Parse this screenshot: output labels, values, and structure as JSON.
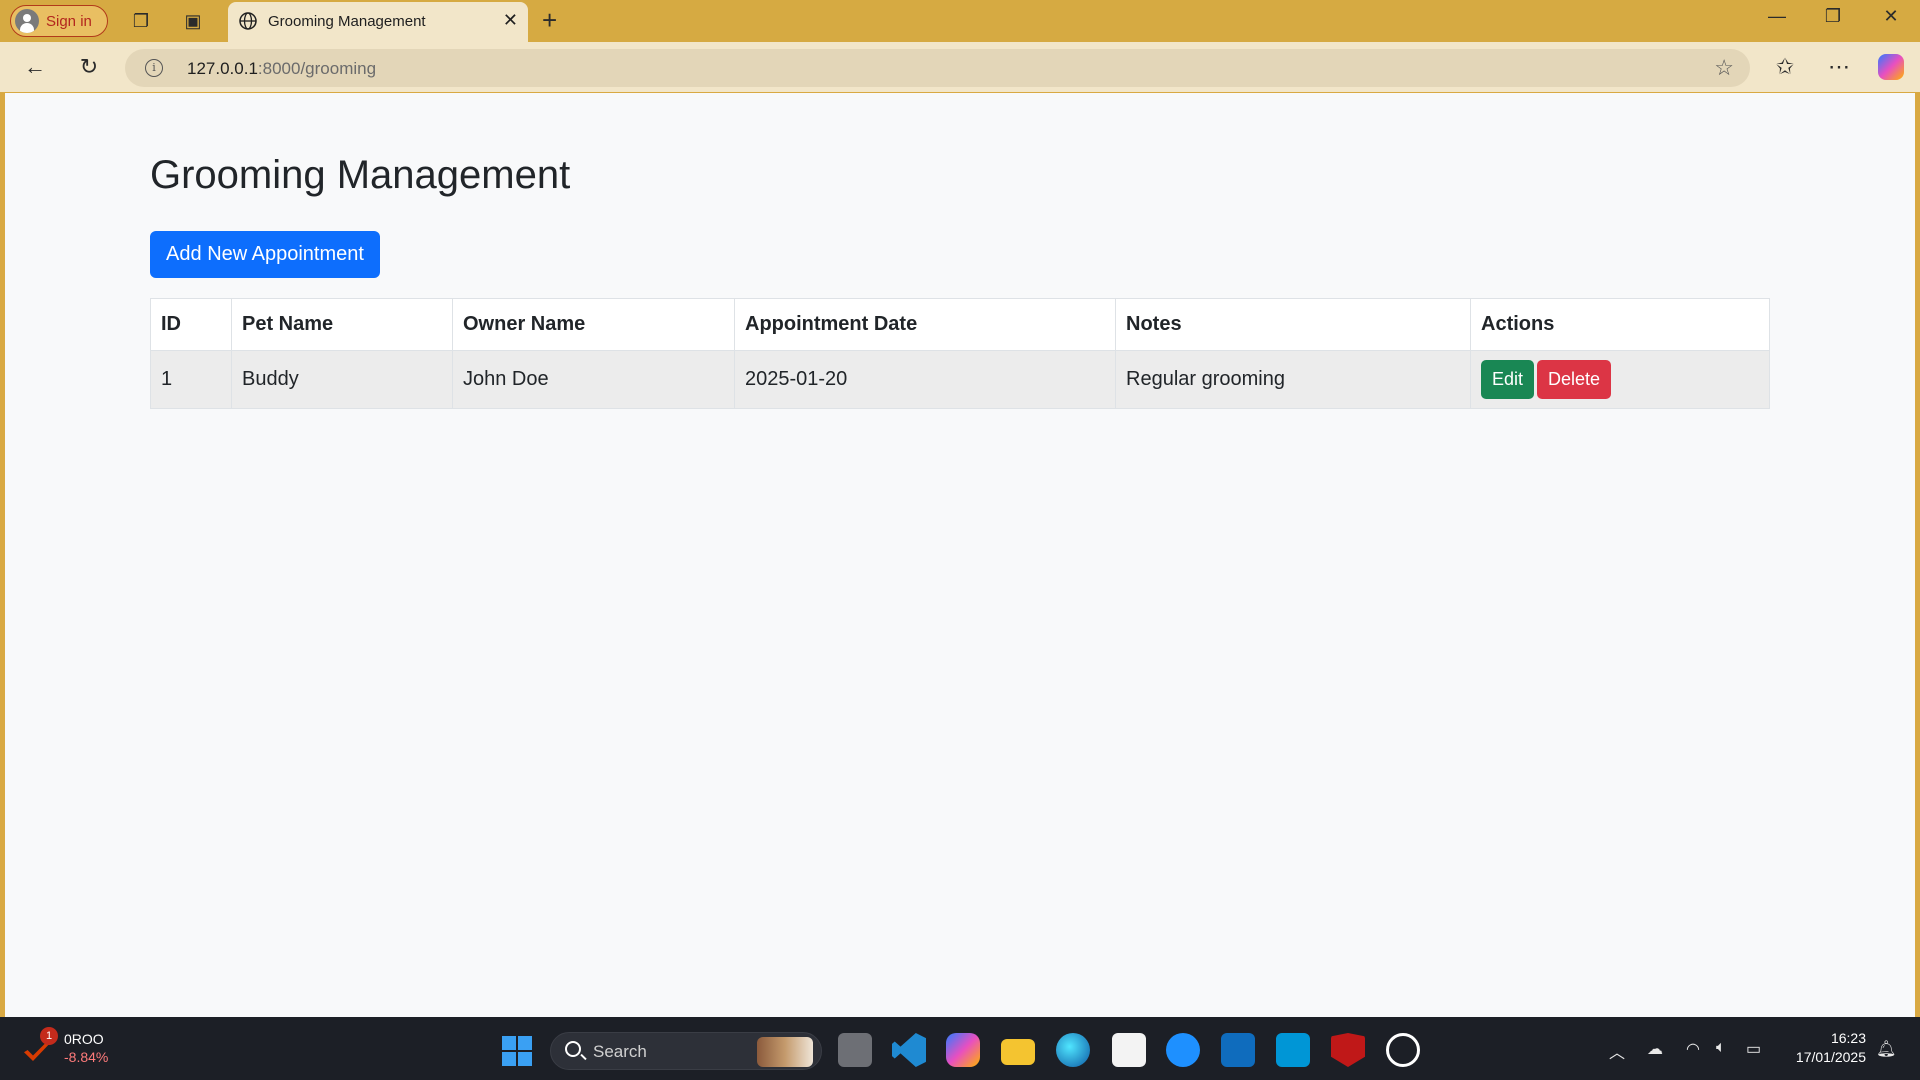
{
  "browser": {
    "signin_label": "Sign in",
    "tab_title": "Grooming Management",
    "url_host": "127.0.0.1",
    "url_path": ":8000/grooming"
  },
  "page": {
    "title": "Grooming Management",
    "add_button_label": "Add New Appointment",
    "table": {
      "headers": {
        "id": "ID",
        "pet_name": "Pet Name",
        "owner_name": "Owner Name",
        "appointment_date": "Appointment Date",
        "notes": "Notes",
        "actions": "Actions"
      },
      "rows": [
        {
          "id": "1",
          "pet_name": "Buddy",
          "owner_name": "John Doe",
          "appointment_date": "2025-01-20",
          "notes": "Regular grooming",
          "edit_label": "Edit",
          "delete_label": "Delete"
        }
      ]
    }
  },
  "taskbar": {
    "stock_symbol": "0ROO",
    "stock_change": "-8.84%",
    "stock_badge": "1",
    "search_placeholder": "Search",
    "time": "16:23",
    "date": "17/01/2025"
  },
  "colors": {
    "primary": "#0d6efd",
    "success": "#198754",
    "danger": "#dc3545",
    "browser_frame": "#d6aa42"
  }
}
